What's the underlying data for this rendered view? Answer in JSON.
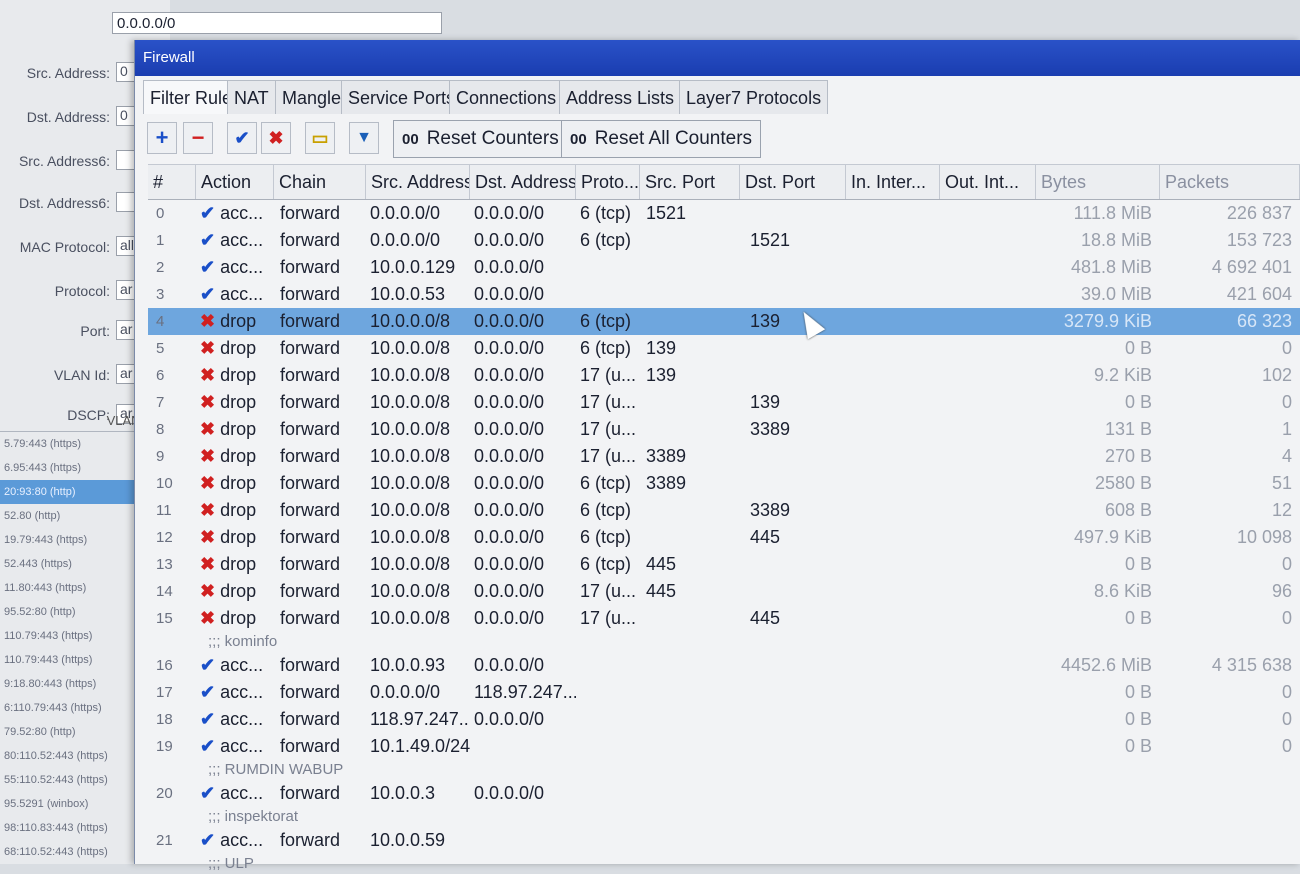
{
  "background_dialog": {
    "top_field_value": "0.0.0.0/0",
    "fields": [
      {
        "label": "Src. Address:",
        "value": "0"
      },
      {
        "label": "Dst. Address:",
        "value": "0"
      },
      {
        "label": "Src. Address6:",
        "value": ""
      },
      {
        "label": "Dst. Address6:",
        "value": ""
      },
      {
        "label": "MAC Protocol:",
        "value": "all"
      },
      {
        "label": "Protocol:",
        "value": "ar"
      },
      {
        "label": "Port:",
        "value": "ar"
      },
      {
        "label": "VLAN Id:",
        "value": "ar"
      },
      {
        "label": "DSCP:",
        "value": "ar"
      }
    ],
    "list_header": "VLAN Id",
    "list_rows": [
      "5.79:443 (https)",
      "6.95:443 (https)",
      "20:93:80 (http)",
      "52.80 (http)",
      "19.79:443 (https)",
      "52.443 (https)",
      "11.80:443 (https)",
      "95.52:80 (http)",
      "110.79:443 (https)",
      "110.79:443 (https)",
      "9:18.80:443 (https)",
      "6:110.79:443 (https)",
      "79.52:80 (http)",
      "80:110.52:443 (https)",
      "55:110.52:443 (https)",
      "95.5291 (winbox)",
      "98:110.83:443 (https)",
      "68:110.52:443 (https)"
    ]
  },
  "window": {
    "title": "Firewall",
    "tabs": [
      "Filter Rules",
      "NAT",
      "Mangle",
      "Service Ports",
      "Connections",
      "Address Lists",
      "Layer7 Protocols"
    ],
    "toolbar": {
      "add": "+",
      "remove": "−",
      "enable": "✔",
      "disable": "✖",
      "comment": "▭",
      "filter": "▼",
      "reset_counters_icon": "00",
      "reset_counters": "Reset Counters",
      "reset_all_icon": "00",
      "reset_all": "Reset All Counters"
    },
    "columns": [
      "#",
      "Action",
      "Chain",
      "Src. Address",
      "Dst. Address",
      "Proto...",
      "Src. Port",
      "Dst. Port",
      "In. Inter...",
      "Out. Int...",
      "Bytes",
      "Packets"
    ],
    "rows": [
      {
        "n": "0",
        "action": "acc...",
        "chain": "forward",
        "src": "0.0.0.0/0",
        "dst": "0.0.0.0/0",
        "proto": "6 (tcp)",
        "sport": "1521",
        "dport": "",
        "bytes": "111.8 MiB",
        "packets": "226 837"
      },
      {
        "n": "1",
        "action": "acc...",
        "chain": "forward",
        "src": "0.0.0.0/0",
        "dst": "0.0.0.0/0",
        "proto": "6 (tcp)",
        "sport": "",
        "dport": "1521",
        "bytes": "18.8 MiB",
        "packets": "153 723"
      },
      {
        "n": "2",
        "action": "acc...",
        "chain": "forward",
        "src": "10.0.0.129",
        "dst": "0.0.0.0/0",
        "proto": "",
        "sport": "",
        "dport": "",
        "bytes": "481.8 MiB",
        "packets": "4 692 401"
      },
      {
        "n": "3",
        "action": "acc...",
        "chain": "forward",
        "src": "10.0.0.53",
        "dst": "0.0.0.0/0",
        "proto": "",
        "sport": "",
        "dport": "",
        "bytes": "39.0 MiB",
        "packets": "421 604"
      },
      {
        "n": "4",
        "action": "drop",
        "chain": "forward",
        "src": "10.0.0.0/8",
        "dst": "0.0.0.0/0",
        "proto": "6 (tcp)",
        "sport": "",
        "dport": "139",
        "bytes": "3279.9 KiB",
        "packets": "66 323",
        "selected": true
      },
      {
        "n": "5",
        "action": "drop",
        "chain": "forward",
        "src": "10.0.0.0/8",
        "dst": "0.0.0.0/0",
        "proto": "6 (tcp)",
        "sport": "139",
        "dport": "",
        "bytes": "0 B",
        "packets": "0"
      },
      {
        "n": "6",
        "action": "drop",
        "chain": "forward",
        "src": "10.0.0.0/8",
        "dst": "0.0.0.0/0",
        "proto": "17 (u...",
        "sport": "139",
        "dport": "",
        "bytes": "9.2 KiB",
        "packets": "102"
      },
      {
        "n": "7",
        "action": "drop",
        "chain": "forward",
        "src": "10.0.0.0/8",
        "dst": "0.0.0.0/0",
        "proto": "17 (u...",
        "sport": "",
        "dport": "139",
        "bytes": "0 B",
        "packets": "0"
      },
      {
        "n": "8",
        "action": "drop",
        "chain": "forward",
        "src": "10.0.0.0/8",
        "dst": "0.0.0.0/0",
        "proto": "17 (u...",
        "sport": "",
        "dport": "3389",
        "bytes": "131 B",
        "packets": "1"
      },
      {
        "n": "9",
        "action": "drop",
        "chain": "forward",
        "src": "10.0.0.0/8",
        "dst": "0.0.0.0/0",
        "proto": "17 (u...",
        "sport": "3389",
        "dport": "",
        "bytes": "270 B",
        "packets": "4"
      },
      {
        "n": "10",
        "action": "drop",
        "chain": "forward",
        "src": "10.0.0.0/8",
        "dst": "0.0.0.0/0",
        "proto": "6 (tcp)",
        "sport": "3389",
        "dport": "",
        "bytes": "2580 B",
        "packets": "51"
      },
      {
        "n": "11",
        "action": "drop",
        "chain": "forward",
        "src": "10.0.0.0/8",
        "dst": "0.0.0.0/0",
        "proto": "6 (tcp)",
        "sport": "",
        "dport": "3389",
        "bytes": "608 B",
        "packets": "12"
      },
      {
        "n": "12",
        "action": "drop",
        "chain": "forward",
        "src": "10.0.0.0/8",
        "dst": "0.0.0.0/0",
        "proto": "6 (tcp)",
        "sport": "",
        "dport": "445",
        "bytes": "497.9 KiB",
        "packets": "10 098"
      },
      {
        "n": "13",
        "action": "drop",
        "chain": "forward",
        "src": "10.0.0.0/8",
        "dst": "0.0.0.0/0",
        "proto": "6 (tcp)",
        "sport": "445",
        "dport": "",
        "bytes": "0 B",
        "packets": "0"
      },
      {
        "n": "14",
        "action": "drop",
        "chain": "forward",
        "src": "10.0.0.0/8",
        "dst": "0.0.0.0/0",
        "proto": "17 (u...",
        "sport": "445",
        "dport": "",
        "bytes": "8.6 KiB",
        "packets": "96"
      },
      {
        "n": "15",
        "action": "drop",
        "chain": "forward",
        "src": "10.0.0.0/8",
        "dst": "0.0.0.0/0",
        "proto": "17 (u...",
        "sport": "",
        "dport": "445",
        "bytes": "0 B",
        "packets": "0"
      },
      {
        "comment": ";;; kominfo"
      },
      {
        "n": "16",
        "action": "acc...",
        "chain": "forward",
        "src": "10.0.0.93",
        "dst": "0.0.0.0/0",
        "proto": "",
        "sport": "",
        "dport": "",
        "bytes": "4452.6 MiB",
        "packets": "4 315 638"
      },
      {
        "n": "17",
        "action": "acc...",
        "chain": "forward",
        "src": "0.0.0.0/0",
        "dst": "118.97.247...",
        "proto": "",
        "sport": "",
        "dport": "",
        "bytes": "0 B",
        "packets": "0"
      },
      {
        "n": "18",
        "action": "acc...",
        "chain": "forward",
        "src": "118.97.247...",
        "dst": "0.0.0.0/0",
        "proto": "",
        "sport": "",
        "dport": "",
        "bytes": "0 B",
        "packets": "0"
      },
      {
        "n": "19",
        "action": "acc...",
        "chain": "forward",
        "src": "10.1.49.0/24",
        "dst": "",
        "proto": "",
        "sport": "",
        "dport": "",
        "bytes": "0 B",
        "packets": "0"
      },
      {
        "comment": ";;; RUMDIN WABUP"
      },
      {
        "n": "20",
        "action": "acc...",
        "chain": "forward",
        "src": "10.0.0.3",
        "dst": "0.0.0.0/0",
        "proto": "",
        "sport": "",
        "dport": "",
        "bytes": "",
        "packets": ""
      },
      {
        "comment": ";;; inspektorat"
      },
      {
        "n": "21",
        "action": "acc...",
        "chain": "forward",
        "src": "10.0.0.59",
        "dst": "",
        "proto": "",
        "sport": "",
        "dport": "",
        "bytes": "",
        "packets": ""
      },
      {
        "comment": ";;; ULP"
      }
    ]
  }
}
